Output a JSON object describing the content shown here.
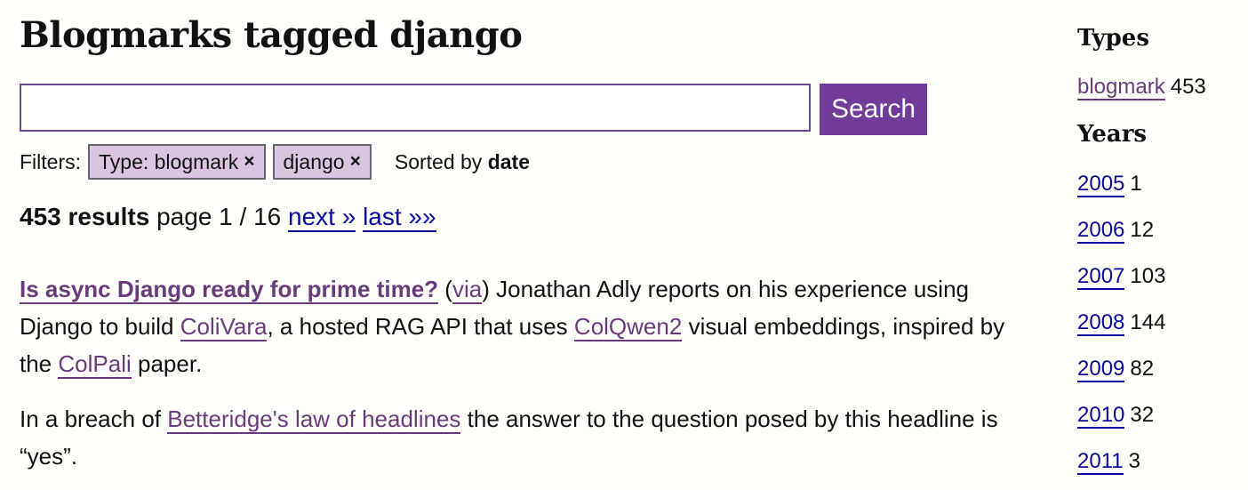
{
  "page": {
    "title": "Blogmarks tagged django"
  },
  "search": {
    "value": "",
    "placeholder": "",
    "button_label": "Search"
  },
  "filters": {
    "label": "Filters:",
    "items": [
      {
        "label": "Type: blogmark",
        "remove_glyph": "×"
      },
      {
        "label": "django",
        "remove_glyph": "×"
      }
    ],
    "sorted_prefix": "Sorted by",
    "sorted_value": "date"
  },
  "results": {
    "count_label": "453 results",
    "page_label": "page 1 / 16",
    "next_label": "next »",
    "last_label": "last »»"
  },
  "entry": {
    "title": "Is async Django ready for prime time?",
    "via_open": "(",
    "via_label": "via",
    "via_close": ")",
    "text1": "Jonathan Adly reports on his experience using Django to build",
    "link_colivara": "ColiVara",
    "text2": ", a hosted RAG API that uses",
    "link_colqwen2": "ColQwen2",
    "text3": "visual embeddings, inspired by the",
    "link_colpali": "ColPali",
    "text4": "paper.",
    "p2_text1": "In a breach of",
    "p2_link": "Betteridge's law of headlines",
    "p2_text2": "the answer to the question posed by this headline is “yes”."
  },
  "sidebar": {
    "types_heading": "Types",
    "types": [
      {
        "label": "blogmark",
        "count": "453"
      }
    ],
    "years_heading": "Years",
    "years": [
      {
        "label": "2005",
        "count": "1"
      },
      {
        "label": "2006",
        "count": "12"
      },
      {
        "label": "2007",
        "count": "103"
      },
      {
        "label": "2008",
        "count": "144"
      },
      {
        "label": "2009",
        "count": "82"
      },
      {
        "label": "2010",
        "count": "32"
      },
      {
        "label": "2011",
        "count": "3"
      }
    ]
  },
  "colors": {
    "accent": "#713c99",
    "pill_bg": "#d9c5df",
    "visited_link": "#693b7a",
    "link": "#0a0aa0"
  }
}
